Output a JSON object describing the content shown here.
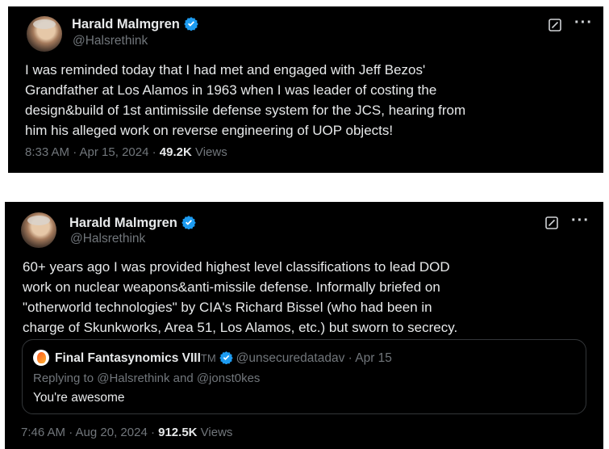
{
  "tweets": [
    {
      "author": {
        "name": "Harald Malmgren",
        "handle": "@Halsrethink"
      },
      "text": "I was reminded today that I had met and engaged with Jeff Bezos'\nGrandfather at Los Alamos in 1963 when I was leader of costing the\ndesign&build of 1st antimissile defense system for the JCS, hearing from\nhim his alleged work on reverse engineering of UOP objects!",
      "time": "8:33 AM · Apr 15, 2024 · ",
      "views_count": "49.2K",
      "views_label": " Views"
    },
    {
      "author": {
        "name": "Harald Malmgren",
        "handle": "@Halsrethink"
      },
      "text": "60+ years ago I was provided highest level classifications to lead DOD\nwork on nuclear weapons&anti-missile defense. Informally briefed on\n\"otherworld technologies\" by CIA's Richard Bissel (who had been in\ncharge of Skunkworks, Area 51, Los Alamos, etc.) but sworn to secrecy.",
      "time": "7:46 AM · Aug 20, 2024 · ",
      "views_count": "912.5K",
      "views_label": " Views",
      "quote": {
        "name": "Final Fantasynomics VIII",
        "tm": "TM",
        "handle": "@unsecuredatadav · Apr 15",
        "replying": "Replying to @Halsrethink and @jonst0kes",
        "text": "You're awesome"
      }
    }
  ],
  "icons": {
    "verified": "verified-badge-icon",
    "grok": "grok-icon",
    "more": "more-icon"
  },
  "colors": {
    "background": "#000000",
    "text": "#e7e9ea",
    "muted": "#71767b",
    "verified": "#1d9bf0",
    "border": "#333639"
  }
}
